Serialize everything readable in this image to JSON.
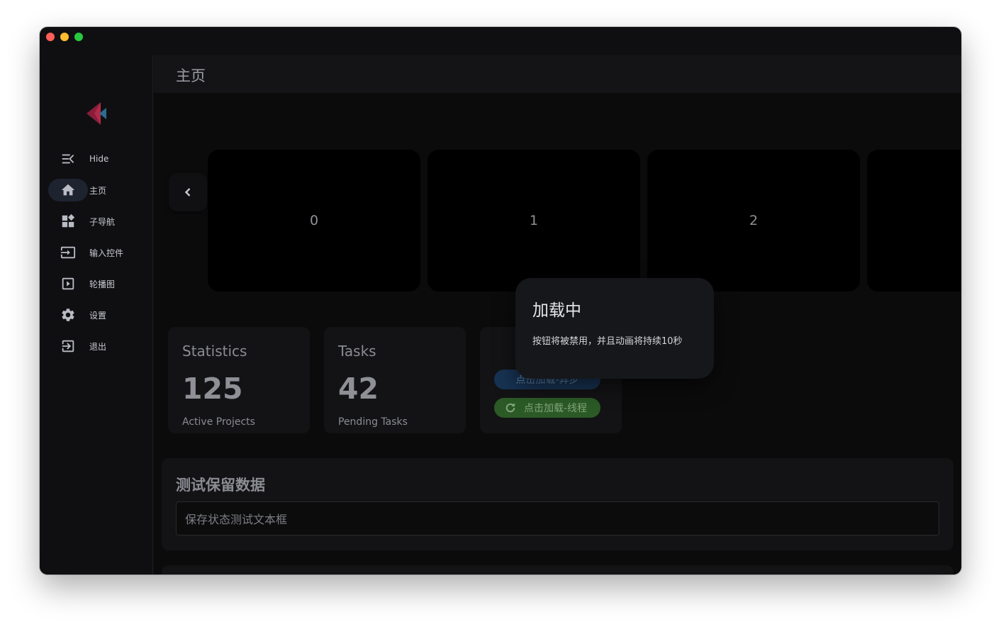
{
  "app": {
    "title": "主页",
    "colors": {
      "accent": "#173252",
      "success": "#2b5a26",
      "background": "#0f0f11"
    }
  },
  "sidebar": {
    "items": [
      {
        "label": "Hide",
        "icon": "menu-collapse-icon"
      },
      {
        "label": "主页",
        "icon": "home-icon",
        "active": true
      },
      {
        "label": "子导航",
        "icon": "widgets-icon"
      },
      {
        "label": "输入控件",
        "icon": "input-icon"
      },
      {
        "label": "轮播图",
        "icon": "play-slides-icon"
      },
      {
        "label": "设置",
        "icon": "gear-icon"
      },
      {
        "label": "退出",
        "icon": "logout-icon"
      }
    ]
  },
  "carousel": {
    "prev_icon": "chevron-left-icon",
    "slides": [
      "0",
      "1",
      "2",
      ""
    ]
  },
  "cards": [
    {
      "title": "Statistics",
      "value": "125",
      "subtitle": "Active Projects"
    },
    {
      "title": "Tasks",
      "value": "42",
      "subtitle": "Pending Tasks"
    }
  ],
  "buttons": {
    "async_label": "点击加载-异步",
    "thread_label": "点击加载-线程",
    "thread_icon": "refresh-icon"
  },
  "panel": {
    "title": "测试保留数据",
    "input_placeholder": "保存状态测试文本框"
  },
  "panel2": {
    "icons": [
      "info-icon",
      "heart-icon",
      "share-icon"
    ]
  },
  "dialog": {
    "title": "加载中",
    "message": "按钮将被禁用，并且动画将持续10秒"
  }
}
